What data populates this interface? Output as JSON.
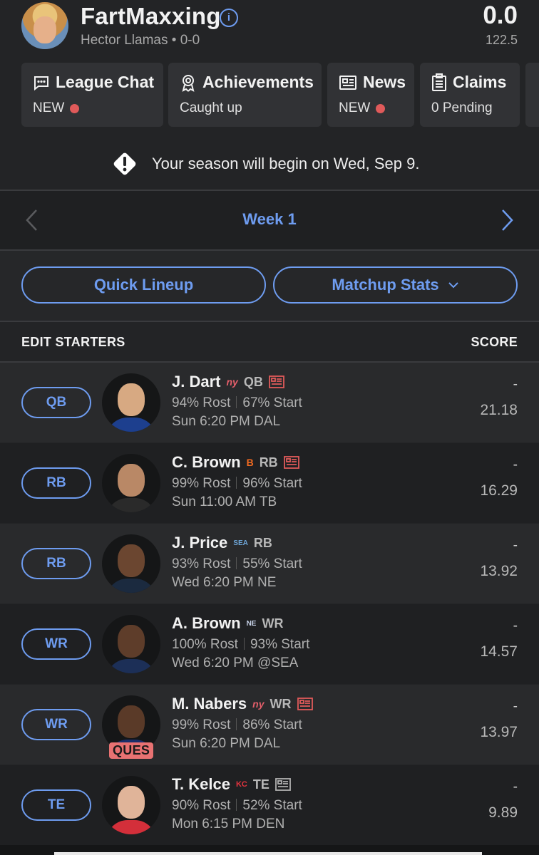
{
  "header": {
    "team_name": "FartMaxxing",
    "owner_record": "Hector Llamas • 0-0",
    "total_score": "0.0",
    "projected_score": "122.5"
  },
  "cards": [
    {
      "title": "League Chat",
      "sub": "NEW",
      "dot": true,
      "icon": "chat-icon"
    },
    {
      "title": "Achievements",
      "sub": "Caught up",
      "dot": false,
      "icon": "award-icon"
    },
    {
      "title": "News",
      "sub": "NEW",
      "dot": true,
      "icon": "news-icon"
    },
    {
      "title": "Claims",
      "sub": "0 Pending",
      "dot": false,
      "icon": "clipboard-icon"
    }
  ],
  "season_notice": "Your season will begin on Wed, Sep 9.",
  "week": {
    "label": "Week 1"
  },
  "buttons": {
    "quick_lineup": "Quick Lineup",
    "matchup_stats": "Matchup Stats"
  },
  "starters": {
    "heading": "EDIT STARTERS",
    "score_heading": "SCORE"
  },
  "players": [
    {
      "slot": "QB",
      "name": "J. Dart",
      "team_logo": "ny",
      "position": "QB",
      "rost": "94% Rost",
      "start": "67% Start",
      "game": "Sun 6:20 PM DAL",
      "score": "-",
      "proj": "21.18",
      "news": true,
      "status": ""
    },
    {
      "slot": "RB",
      "name": "C. Brown",
      "team_logo": "B",
      "position": "RB",
      "rost": "99% Rost",
      "start": "96% Start",
      "game": "Sun 11:00 AM TB",
      "score": "-",
      "proj": "16.29",
      "news": true,
      "status": ""
    },
    {
      "slot": "RB",
      "name": "J. Price",
      "team_logo": "SEA",
      "position": "RB",
      "rost": "93% Rost",
      "start": "55% Start",
      "game": "Wed 6:20 PM NE",
      "score": "-",
      "proj": "13.92",
      "news": false,
      "status": ""
    },
    {
      "slot": "WR",
      "name": "A. Brown",
      "team_logo": "NE",
      "position": "WR",
      "rost": "100% Rost",
      "start": "93% Start",
      "game": "Wed 6:20 PM @SEA",
      "score": "-",
      "proj": "14.57",
      "news": false,
      "status": ""
    },
    {
      "slot": "WR",
      "name": "M. Nabers",
      "team_logo": "ny",
      "position": "WR",
      "rost": "99% Rost",
      "start": "86% Start",
      "game": "Sun 6:20 PM DAL",
      "score": "-",
      "proj": "13.97",
      "news": true,
      "status": "QUES"
    },
    {
      "slot": "TE",
      "name": "T. Kelce",
      "team_logo": "KC",
      "position": "TE",
      "rost": "90% Rost",
      "start": "52% Start",
      "game": "Mon 6:15 PM DEN",
      "score": "-",
      "proj": "9.89",
      "news": true,
      "status": ""
    }
  ],
  "colors": {
    "accent": "#6e9cf0",
    "new_dot": "#e05a5a",
    "ques_badge": "#e87272"
  }
}
